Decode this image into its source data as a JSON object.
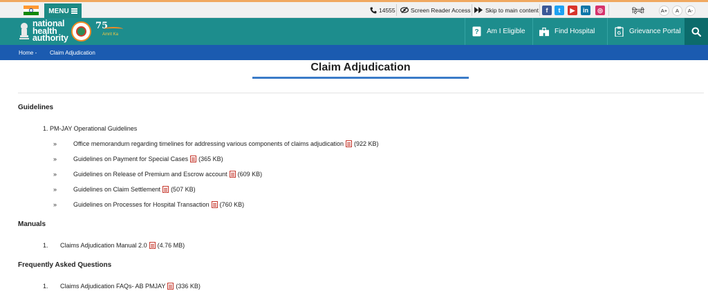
{
  "utility_bar": {
    "menu_label": "MENU",
    "phone_number": "14555",
    "screen_reader_label": "Screen Reader Access",
    "skip_label": "Skip to main content",
    "social": [
      {
        "name": "facebook-icon",
        "glyph": "f",
        "color": "#3b5998"
      },
      {
        "name": "twitter-icon",
        "glyph": "t",
        "color": "#1da1f2"
      },
      {
        "name": "youtube-icon",
        "glyph": "▶",
        "color": "#d9342b"
      },
      {
        "name": "linkedin-icon",
        "glyph": "in",
        "color": "#0e76a8"
      },
      {
        "name": "instagram-icon",
        "glyph": "◎",
        "color": "#d6336c"
      }
    ],
    "language_label": "हिन्दी",
    "font_sizes": [
      "A+",
      "A",
      "A-"
    ]
  },
  "header": {
    "logo_line1": "national",
    "logo_line2": "health",
    "logo_line3": "authority",
    "azadi_number": "75",
    "azadi_text": "Amrit Ka",
    "nav": [
      {
        "label": "Am I Eligible",
        "icon": "eligibility-icon"
      },
      {
        "label": "Find Hospital",
        "icon": "hospital-icon"
      },
      {
        "label": "Grievance Portal",
        "icon": "grievance-icon"
      }
    ]
  },
  "breadcrumb": {
    "home": "Home -",
    "current": "Claim Adjudication"
  },
  "page": {
    "title": "Claim Adjudication",
    "guidelines_heading": "Guidelines",
    "guidelines_sub": "1. PM-JAY Operational Guidelines",
    "guidelines_items": [
      {
        "text": "Office memorandum regarding timelines for addressing various components of claims adjudication",
        "size": "(922 KB)"
      },
      {
        "text": "Guidelines on Payment for Special Cases",
        "size": "(365 KB)"
      },
      {
        "text": "Guidelines on Release of Premium and Escrow account",
        "size": "(609 KB)"
      },
      {
        "text": "Guidelines on Claim Settlement",
        "size": "(507 KB)"
      },
      {
        "text": "Guidelines on Processes for Hospital Transaction",
        "size": "(760 KB)"
      }
    ],
    "manuals_heading": "Manuals",
    "manuals_number": "1.",
    "manuals_item": {
      "text": "Claims Adjudication Manual 2.0",
      "size": "(4.76 MB)"
    },
    "faq_heading": "Frequently Asked Questions",
    "faq_number": "1.",
    "faq_item": {
      "text": "Claims Adjudication FAQs- AB PMJAY",
      "size": "(336 KB)"
    },
    "bullet": "»"
  },
  "colors": {
    "header_teal": "#1d8d8d",
    "breadcrumb_blue": "#1b5bb0",
    "accent_blue": "#3a7bc8"
  }
}
